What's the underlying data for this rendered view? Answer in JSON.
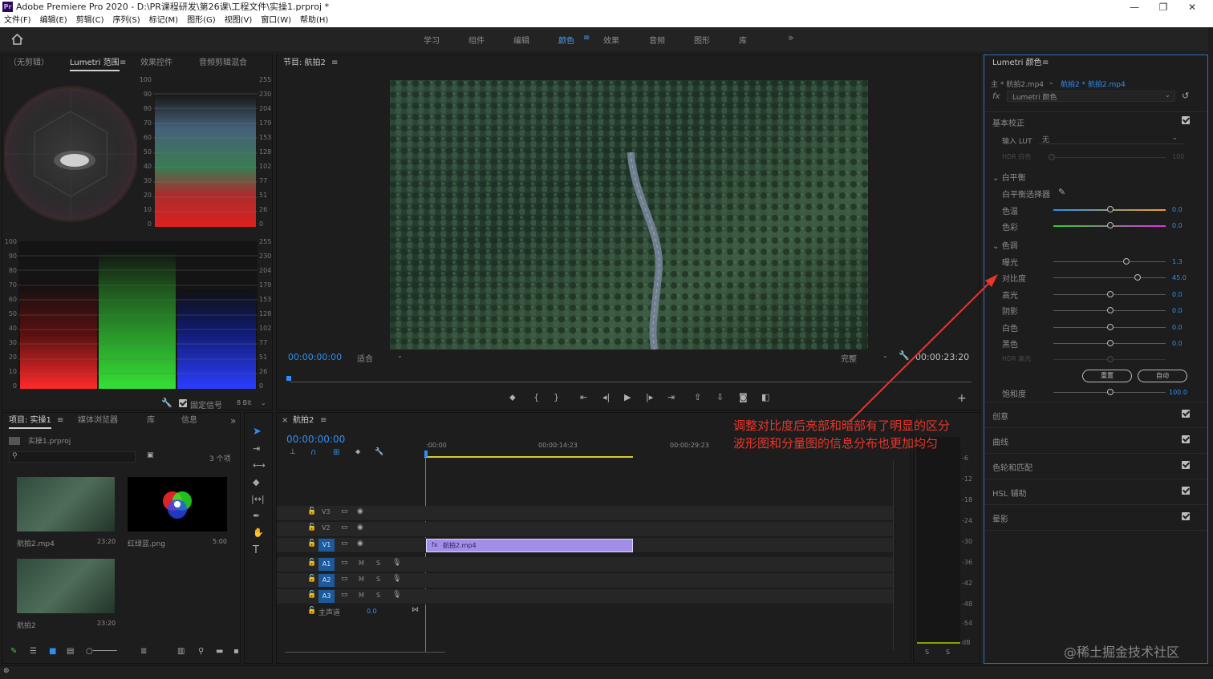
{
  "app": {
    "logo": "Pr",
    "title": "Adobe Premiere Pro 2020 - D:\\PR课程研发\\第26课\\工程文件\\实操1.prproj *"
  },
  "window": {
    "minimize": "—",
    "restore": "❐",
    "close": "✕"
  },
  "menu": [
    "文件(F)",
    "编辑(E)",
    "剪辑(C)",
    "序列(S)",
    "标记(M)",
    "图形(G)",
    "视图(V)",
    "窗口(W)",
    "帮助(H)"
  ],
  "workspaces": {
    "items": [
      "学习",
      "组件",
      "编辑",
      "颜色",
      "效果",
      "音频",
      "图形",
      "库"
    ],
    "active_index": 3,
    "more": "»"
  },
  "scopes": {
    "tabs": [
      "（无剪辑）",
      "Lumetri 范围",
      "效果控件",
      "音频剪辑混合"
    ],
    "active_index": 1,
    "left_scale": [
      "100",
      "90",
      "80",
      "70",
      "60",
      "50",
      "40",
      "30",
      "20",
      "10",
      "0"
    ],
    "right_scale": [
      "255",
      "230",
      "204",
      "179",
      "153",
      "128",
      "102",
      "77",
      "51",
      "26",
      "0"
    ],
    "clamp": "固定信号",
    "bitdepth": "8 Bit"
  },
  "program": {
    "title": "节目: 航拍2",
    "timecode": "00:00:00:00",
    "fit": "适合",
    "quality": "完整",
    "duration": "00:00:23:20"
  },
  "project": {
    "tabs": [
      "项目: 实操1",
      "媒体浏览器",
      "库",
      "信息"
    ],
    "file": "实操1.prproj",
    "count": "3 个项",
    "items": [
      {
        "name": "航拍2.mp4",
        "dur": "23:20"
      },
      {
        "name": "红绿蓝.png",
        "dur": "5:00"
      },
      {
        "name": "航拍2",
        "dur": "23:20"
      }
    ]
  },
  "timeline": {
    "title": "航拍2",
    "timecode": "00:00:00:00",
    "ruler": [
      ":00:00",
      "00:00:14:23",
      "00:00:29:23"
    ],
    "tracks_video": [
      "V3",
      "V2",
      "V1"
    ],
    "tracks_audio": [
      "A1",
      "A2",
      "A3"
    ],
    "master": "主声道",
    "master_val": "0.0",
    "clip": "航拍2.mp4",
    "m": "M",
    "s": "S"
  },
  "meters": {
    "scale": [
      "-6",
      "-12",
      "-18",
      "-24",
      "-30",
      "-36",
      "-42",
      "-48",
      "-54",
      "dB"
    ],
    "solo": [
      "S",
      "S"
    ]
  },
  "lumetri": {
    "title": "Lumetri 颜色",
    "source": "主 * 航拍2.mp4",
    "seq": "航拍2 * 航拍2.mp4",
    "fx": "Lumetri 颜色",
    "basic": "基本校正",
    "input_lut": "输入 LUT",
    "lut_value": "无",
    "hdr_white": "HDR 白色",
    "hdr_white_val": "100",
    "wb": "白平衡",
    "wb_picker": "白平衡选择器",
    "temp": "色温",
    "tint": "色彩",
    "tone": "色调",
    "exposure": "曝光",
    "contrast": "对比度",
    "highlights": "高光",
    "shadows": "阴影",
    "whites": "白色",
    "blacks": "黑色",
    "hdr_spec": "HDR 高光",
    "reset": "重置",
    "auto": "自动",
    "saturation": "饱和度",
    "vals": {
      "temp": "0.0",
      "tint": "0.0",
      "exposure": "1.3",
      "contrast": "45.0",
      "highlights": "0.0",
      "shadows": "0.0",
      "whites": "0.0",
      "blacks": "0.0",
      "saturation": "100.0"
    },
    "sections": [
      "创意",
      "曲线",
      "色轮和匹配",
      "HSL 辅助",
      "晕影"
    ]
  },
  "annotation": {
    "line1": "调整对比度后亮部和暗部有了明显的区分",
    "line2": "波形图和分量图的信息分布也更加均匀",
    "color": "#e8352b"
  },
  "watermark": "@稀土掘金技术社区"
}
